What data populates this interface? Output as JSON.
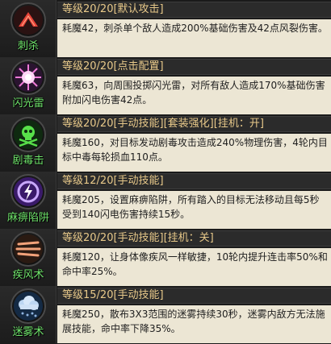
{
  "skills": [
    {
      "name": "刺杀",
      "header": "等级20/20[默认攻击]",
      "desc": "耗魔42，刺杀单个敌人造成200%基础伤害及42点风裂伤害。",
      "icon": "assassinate-icon"
    },
    {
      "name": "闪光雷",
      "header": "等级20/20[点击配置]",
      "desc": "耗魔63，向周围投掷闪光雷，对所有敌人造成170%基础伤害附加闪电伤害42点。",
      "icon": "flash-burst-icon"
    },
    {
      "name": "剧毒击",
      "header": "等级20/20[手动技能][套装强化][挂机：开]",
      "desc": "耗魔160，对目标发动剧毒攻击造成240%物理伤害，4轮内目标中毒每轮损血110点。",
      "icon": "poison-skull-icon"
    },
    {
      "name": "麻痹陷阱",
      "header": "等级12/20[手动技能]",
      "desc": "耗魔205，设置麻痹陷阱，所有踏入的目标无法移动且每5秒受到140闪电伤害持续15秒。",
      "icon": "paralysis-trap-icon"
    },
    {
      "name": "疾风术",
      "header": "等级20/20[手动技能][挂机：关]",
      "desc": "耗魔120，让身体像疾风一样敏捷，10轮内提升连击率50%和命中率25%。",
      "icon": "gale-icon"
    },
    {
      "name": "迷雾术",
      "header": "等级15/20[手动技能]",
      "desc": "耗魔250，散布3X3范围的迷雾持续30秒，迷雾内敌方无法施展技能，命中率下降35%。",
      "icon": "fog-cloud-icon"
    }
  ]
}
